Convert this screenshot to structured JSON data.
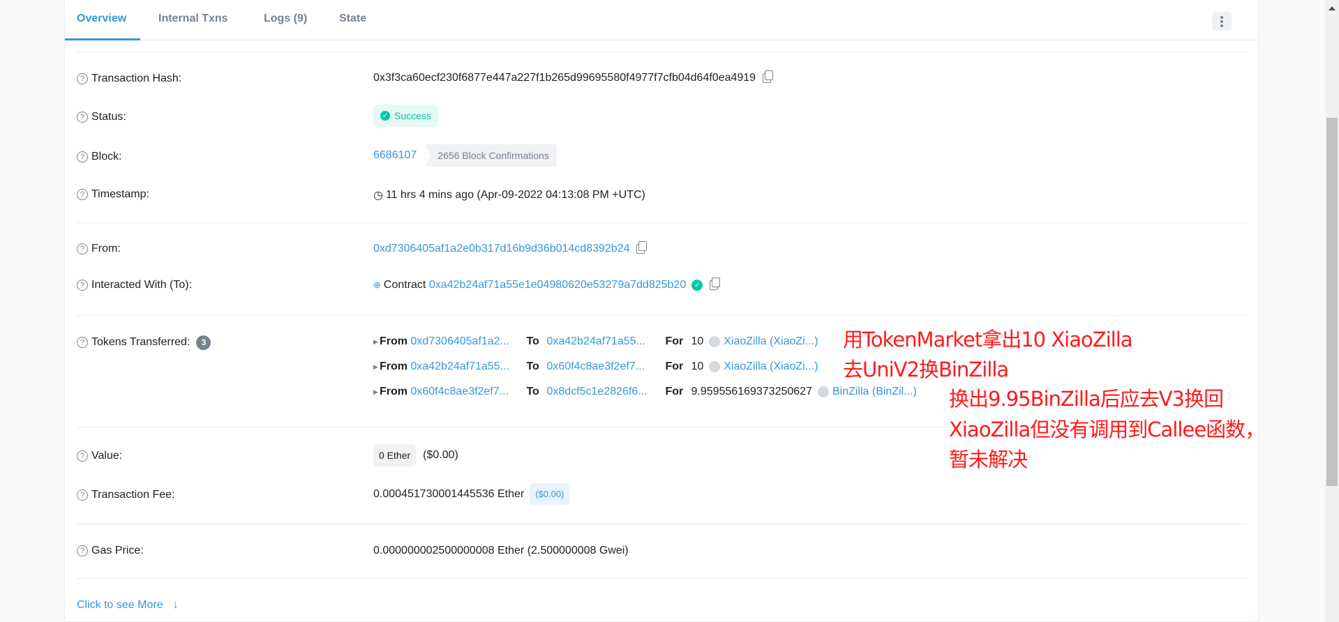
{
  "tabs": [
    "Overview",
    "Internal Txns",
    "Logs (9)",
    "State"
  ],
  "rows": {
    "hash": {
      "label": "Transaction Hash:",
      "value": "0x3f3ca60ecf230f6877e447a227f1b265d99695580f4977f7cfb04d64f0ea4919"
    },
    "status": {
      "label": "Status:",
      "value": "Success"
    },
    "block": {
      "label": "Block:",
      "value": "6686107",
      "confirmations": "2656 Block Confirmations"
    },
    "timestamp": {
      "label": "Timestamp:",
      "value": "11 hrs 4 mins ago (Apr-09-2022 04:13:08 PM +UTC)"
    },
    "from": {
      "label": "From:",
      "value": "0xd7306405af1a2e0b317d16b9d36b014cd8392b24"
    },
    "to": {
      "label": "Interacted With (To):",
      "prefix": "Contract",
      "value": "0xa42b24af71a55e1e04980620e53279a7dd825b20"
    },
    "tokens": {
      "label": "Tokens Transferred:",
      "count": "3",
      "from_label": "From",
      "to_label": "To",
      "for_label": "For",
      "items": [
        {
          "from": "0xd7306405af1a2...",
          "to": "0xa42b24af71a55...",
          "amount": "10",
          "token": "XiaoZilla (XiaoZi...)"
        },
        {
          "from": "0xa42b24af71a55...",
          "to": "0x60f4c8ae3f2ef7...",
          "amount": "10",
          "token": "XiaoZilla (XiaoZi...)"
        },
        {
          "from": "0x60f4c8ae3f2ef7...",
          "to": "0x8dcf5c1e2826f6...",
          "amount": "9.959556169373250627",
          "token": "BinZilla (BinZil...)"
        }
      ]
    },
    "value": {
      "label": "Value:",
      "value": "0 Ether",
      "usd": "($0.00)"
    },
    "fee": {
      "label": "Transaction Fee:",
      "value": "0.000451730001445536 Ether",
      "usd": "($0.00)"
    },
    "gas": {
      "label": "Gas Price:",
      "value": "0.000000002500000008 Ether (2.500000008 Gwei)"
    }
  },
  "more": "Click to see More",
  "annotation": [
    "用TokenMarket拿出10 XiaoZilla",
    "去UniV2换BinZilla",
    "换出9.95BinZilla后应去V3换回",
    "XiaoZilla但没有调用到Callee函数，",
    "暂未解决"
  ],
  "colors": {
    "accent": "#3498db",
    "success": "#00c9a7",
    "annotation": "#ff1a1a"
  }
}
